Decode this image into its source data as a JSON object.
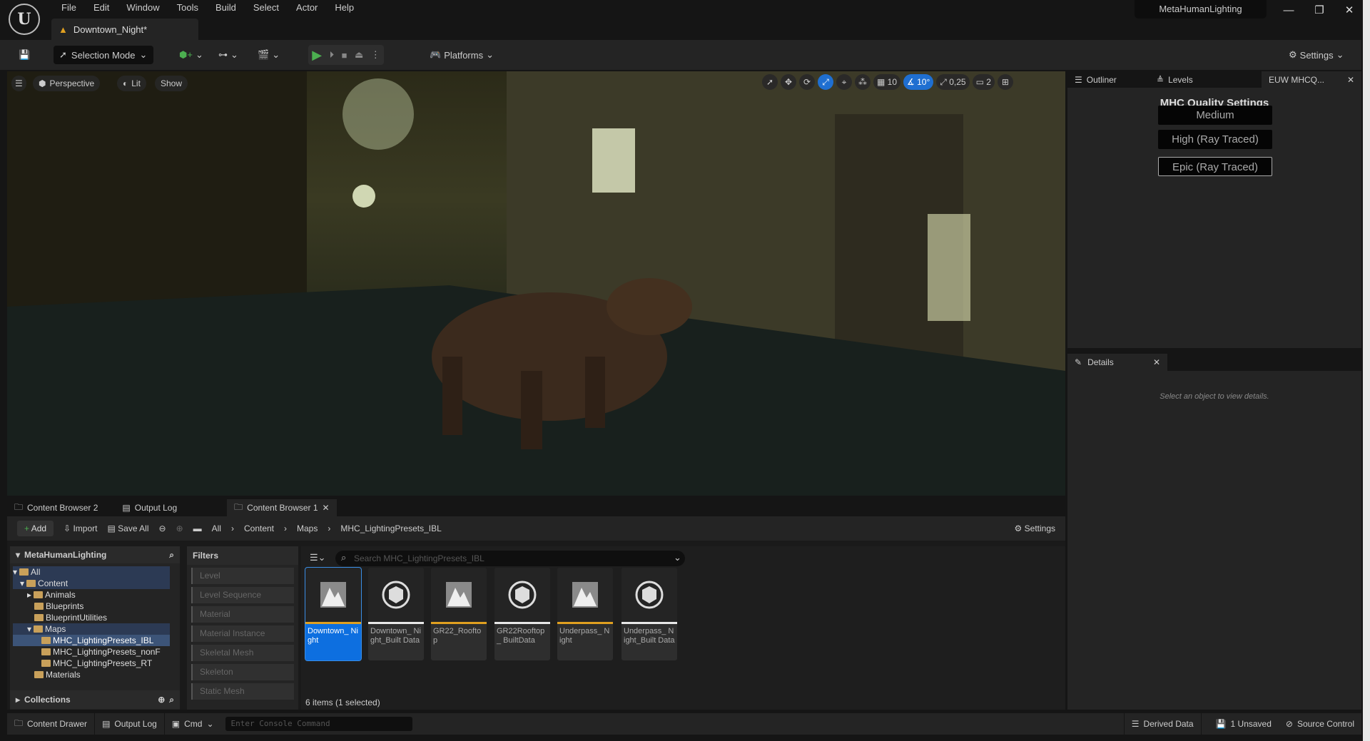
{
  "menubar": {
    "items": [
      "File",
      "Edit",
      "Window",
      "Tools",
      "Build",
      "Select",
      "Actor",
      "Help"
    ],
    "project": "MetaHumanLighting",
    "doc_tab": "Downtown_Night*"
  },
  "toolbar": {
    "selection_mode": "Selection Mode",
    "platforms": "Platforms",
    "settings": "Settings"
  },
  "viewport": {
    "perspective": "Perspective",
    "lit": "Lit",
    "show": "Show",
    "grid": "10",
    "angle": "10°",
    "scale": "0,25",
    "camera_speed": "2"
  },
  "right_tabs": {
    "outliner": "Outliner",
    "levels": "Levels",
    "euw": "EUW MHCQ..."
  },
  "mhc": {
    "title": "MHC Quality Settings",
    "buttons": [
      "Medium",
      "High (Ray Traced)",
      "Epic (Ray Traced)"
    ]
  },
  "details": {
    "tab": "Details",
    "empty": "Select an object to view details."
  },
  "content_tabs": [
    "Content Browser 2",
    "Output Log",
    "Content Browser 1"
  ],
  "content_bar": {
    "add": "Add",
    "import": "Import",
    "save_all": "Save All",
    "breadcrumb": [
      "All",
      "Content",
      "Maps",
      "MHC_LightingPresets_IBL"
    ],
    "settings": "Settings"
  },
  "tree": {
    "root": "MetaHumanLighting",
    "items": [
      "All",
      "Content",
      "Animals",
      "Blueprints",
      "BlueprintUtilities",
      "Maps",
      "MHC_LightingPresets_IBL",
      "MHC_LightingPresets_nonF",
      "MHC_LightingPresets_RT",
      "Materials"
    ],
    "collections": "Collections"
  },
  "filters": {
    "title": "Filters",
    "items": [
      "Level",
      "Level Sequence",
      "Material",
      "Material Instance",
      "Skeletal Mesh",
      "Skeleton",
      "Static Mesh"
    ]
  },
  "assets": {
    "search_placeholder": "Search MHC_LightingPresets_IBL",
    "items": [
      {
        "name": "Downtown_ Night",
        "type": "map"
      },
      {
        "name": "Downtown_ Night_Built Data",
        "type": "data"
      },
      {
        "name": "GR22_Rooftop",
        "type": "map"
      },
      {
        "name": "GR22Rooftop_ BuiltData",
        "type": "data"
      },
      {
        "name": "Underpass_ Night",
        "type": "map"
      },
      {
        "name": "Underpass_ Night_Built Data",
        "type": "data"
      }
    ],
    "count": "6 items (1 selected)"
  },
  "statusbar": {
    "content_drawer": "Content Drawer",
    "output_log": "Output Log",
    "cmd": "Cmd",
    "console_placeholder": "Enter Console Command",
    "derived_data": "Derived Data",
    "unsaved": "1 Unsaved",
    "source_control": "Source Control"
  },
  "colors": {
    "accent": "#0d6fe0",
    "map_bar": "#e0a020",
    "data_bar": "#e8e8e8",
    "play": "#4caf50"
  }
}
